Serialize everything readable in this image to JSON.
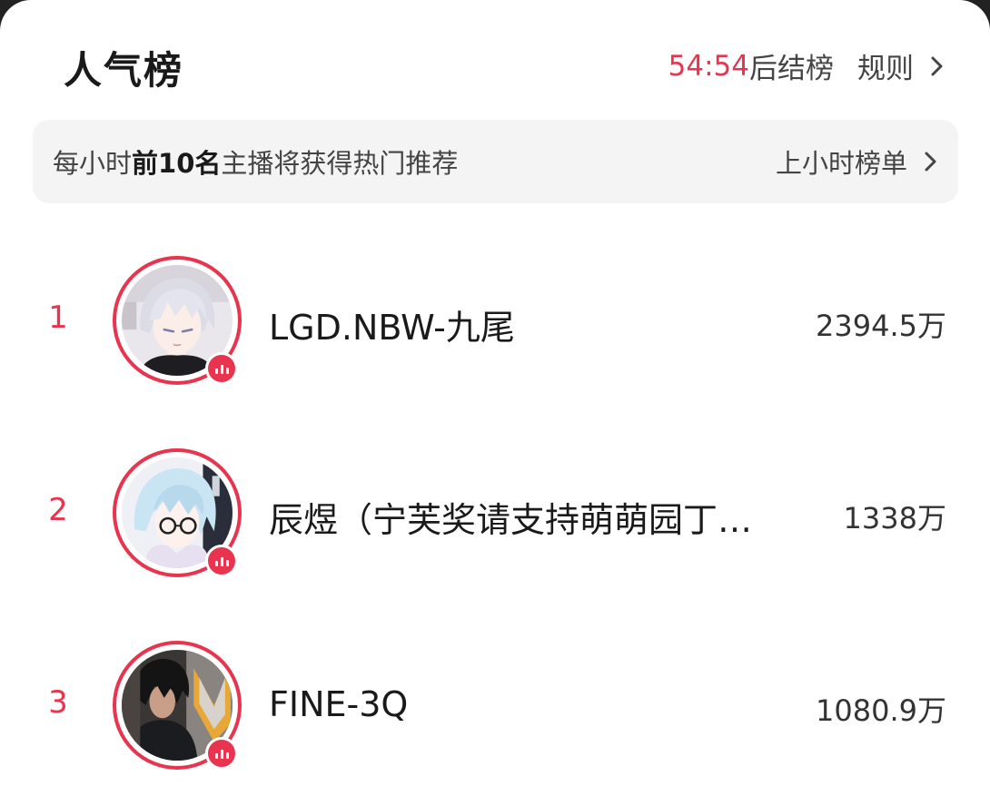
{
  "header": {
    "title": "人气榜",
    "countdown": "54:54",
    "countdown_suffix": "后结榜",
    "rules_label": "规则"
  },
  "banner": {
    "text_prefix": "每小时",
    "text_bold": "前10名",
    "text_suffix": "主播将获得热门推荐",
    "link_label": "上小时榜单"
  },
  "ranking": [
    {
      "rank": "1",
      "name": "LGD.NBW-九尾",
      "score": "2394.5万",
      "avatar_icon": "streamer-avatar",
      "badge_icon": "live-icon"
    },
    {
      "rank": "2",
      "name": "辰煜（宁芙奖请支持萌萌园丁…",
      "score": "1338万",
      "avatar_icon": "streamer-avatar",
      "badge_icon": "live-icon"
    },
    {
      "rank": "3",
      "name": "FINE-3Q",
      "score": "1080.9万",
      "avatar_icon": "streamer-avatar",
      "badge_icon": "live-icon"
    }
  ],
  "colors": {
    "accent": "#e8344e",
    "banner_bg": "#f4f4f4"
  }
}
